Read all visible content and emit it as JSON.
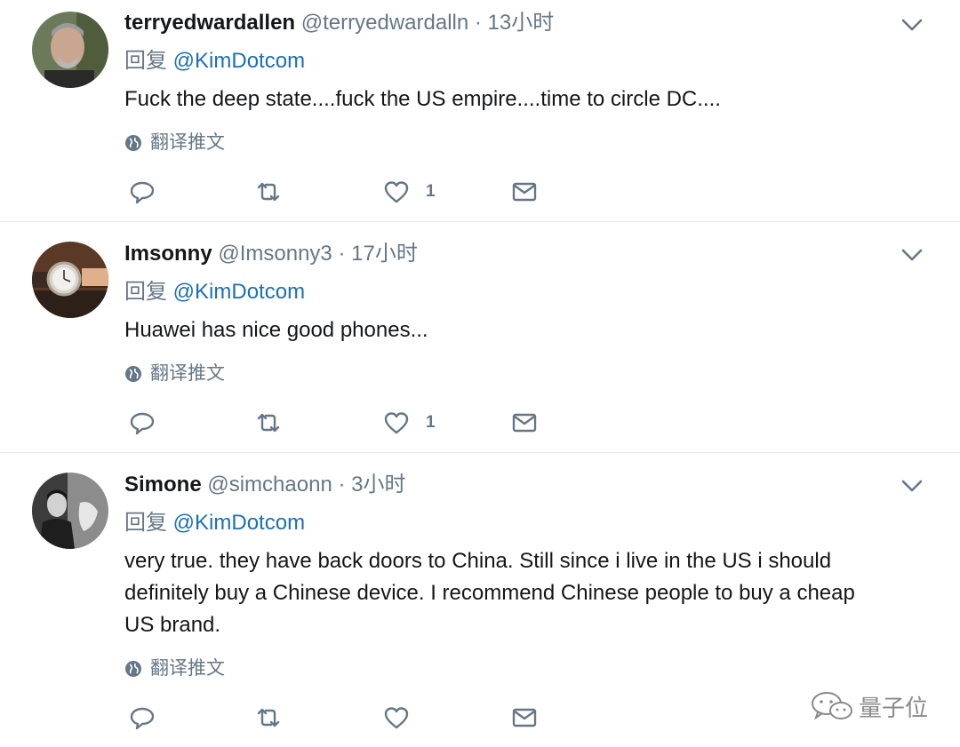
{
  "tweets": [
    {
      "name": "terryedwardallen",
      "handle": "@terryedwardalln",
      "dot": "·",
      "time": "13小时",
      "reply_prefix": "回复",
      "reply_mention": "@KimDotcom",
      "text": [
        "Fuck the deep state....fuck the US empire....time to circle DC...."
      ],
      "translate": "翻译推文",
      "likes": "1"
    },
    {
      "name": "Imsonny",
      "handle": "@Imsonny3",
      "dot": "·",
      "time": "17小时",
      "reply_prefix": "回复",
      "reply_mention": "@KimDotcom",
      "text": [
        "Huawei has nice good phones..."
      ],
      "translate": "翻译推文",
      "likes": "1"
    },
    {
      "name": "Simone",
      "handle": "@simchaonn",
      "dot": "·",
      "time": "3小时",
      "reply_prefix": "回复",
      "reply_mention": "@KimDotcom",
      "text": [
        "very true.  they have back doors to China. Still since i live in the US i should",
        "definitely buy a Chinese device.  I recommend Chinese people to buy a cheap",
        "US brand."
      ],
      "translate": "翻译推文",
      "likes": ""
    }
  ],
  "icons": {
    "reply": "reply-icon",
    "retweet": "retweet-icon",
    "like": "heart-icon",
    "dm": "envelope-icon",
    "menu": "chevron-down-icon",
    "globe": "globe-icon"
  },
  "watermark": "量子位",
  "colors": {
    "link": "#1b6fb5",
    "muted": "#657786",
    "divider": "#e6ecf0"
  }
}
